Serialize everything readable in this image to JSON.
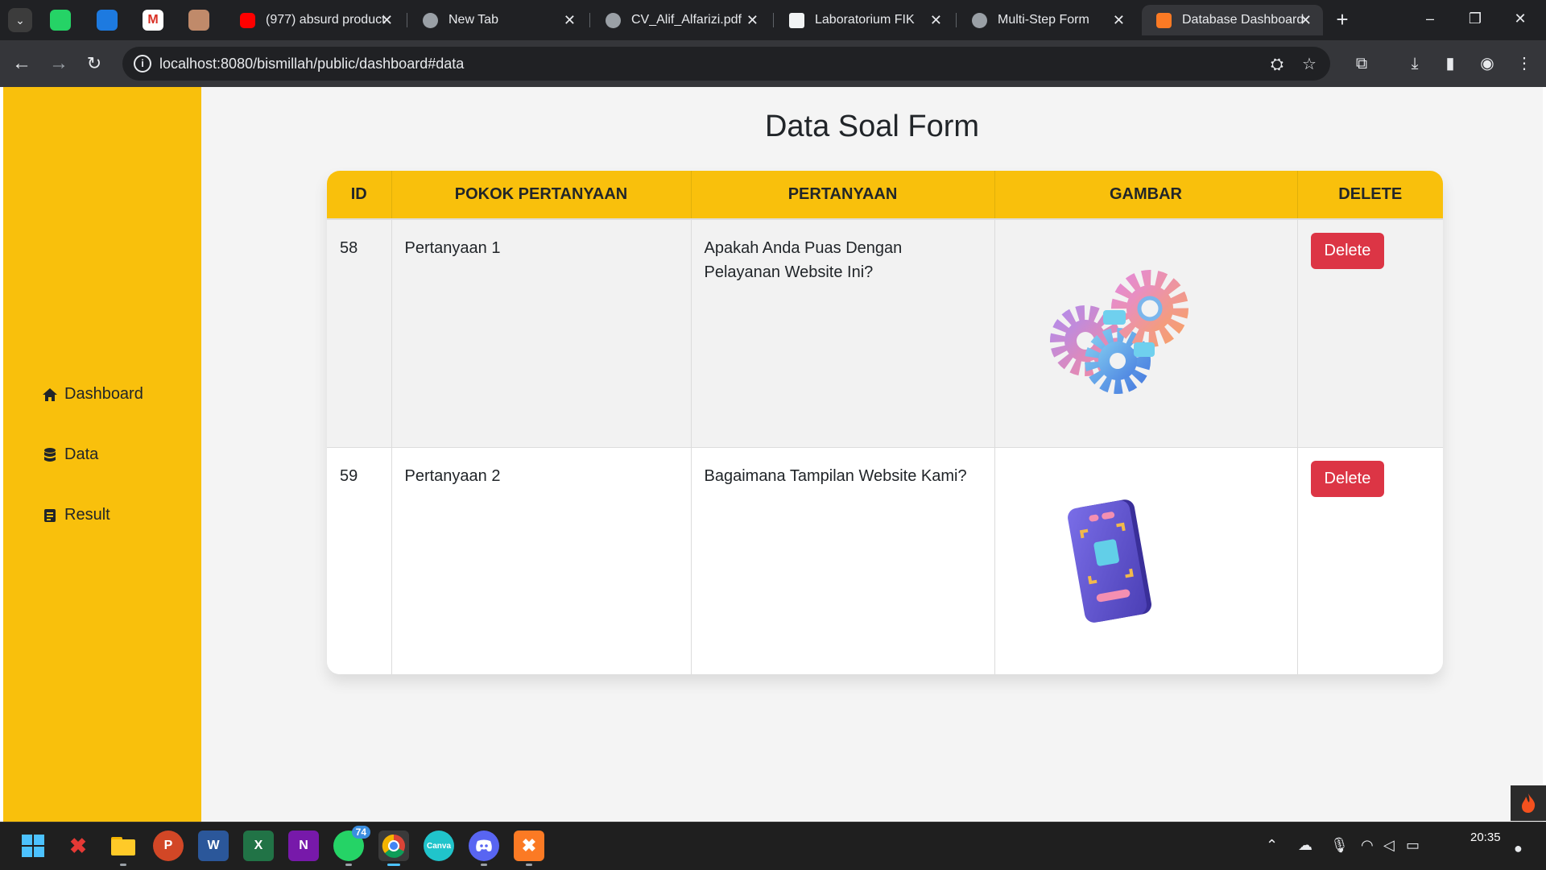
{
  "browser": {
    "pinned_tabs": [
      "whatsapp-icon",
      "trello-icon",
      "gmail-icon",
      "palette-icon"
    ],
    "tabs": [
      {
        "title": "(977) absurd product",
        "icon": "youtube-icon"
      },
      {
        "title": "New Tab",
        "icon": "chrome-icon"
      },
      {
        "title": "CV_Alif_Alfarizi.pdf",
        "icon": "globe-icon"
      },
      {
        "title": "Laboratorium FIK",
        "icon": "site-icon"
      },
      {
        "title": "Multi-Step Form",
        "icon": "globe-icon"
      },
      {
        "title": "Database Dashboard",
        "icon": "xampp-icon",
        "active": true
      }
    ],
    "url": "localhost:8080/bismillah/public/dashboard#data"
  },
  "sidebar": {
    "items": [
      {
        "label": "Dashboard",
        "icon": "home-icon"
      },
      {
        "label": "Data",
        "icon": "database-icon"
      },
      {
        "label": "Result",
        "icon": "document-icon"
      }
    ]
  },
  "main": {
    "title": "Data Soal Form",
    "table": {
      "headers": [
        "ID",
        "POKOK PERTANYAAN",
        "PERTANYAAN",
        "GAMBAR",
        "DELETE"
      ],
      "rows": [
        {
          "id": "58",
          "pokok": "Pertanyaan 1",
          "pertanyaan": "Apakah Anda Puas Dengan Pelayanan Website Ini?",
          "gambar": "gears-3d-image",
          "delete_label": "Delete"
        },
        {
          "id": "59",
          "pokok": "Pertanyaan 2",
          "pertanyaan": "Bagaimana Tampilan Website Kami?",
          "gambar": "phone-3d-image",
          "delete_label": "Delete"
        }
      ]
    }
  },
  "taskbar": {
    "apps": [
      "windows-start-icon",
      "xmind-icon",
      "file-explorer-icon",
      "powerpoint-icon",
      "word-icon",
      "excel-icon",
      "onenote-icon",
      "whatsapp-icon",
      "chrome-icon",
      "canva-icon",
      "discord-icon",
      "xampp-icon"
    ],
    "whatsapp_badge": "74",
    "time": "20:35"
  },
  "colors": {
    "accent_yellow": "#f9c00c",
    "delete_red": "#dc3545"
  }
}
